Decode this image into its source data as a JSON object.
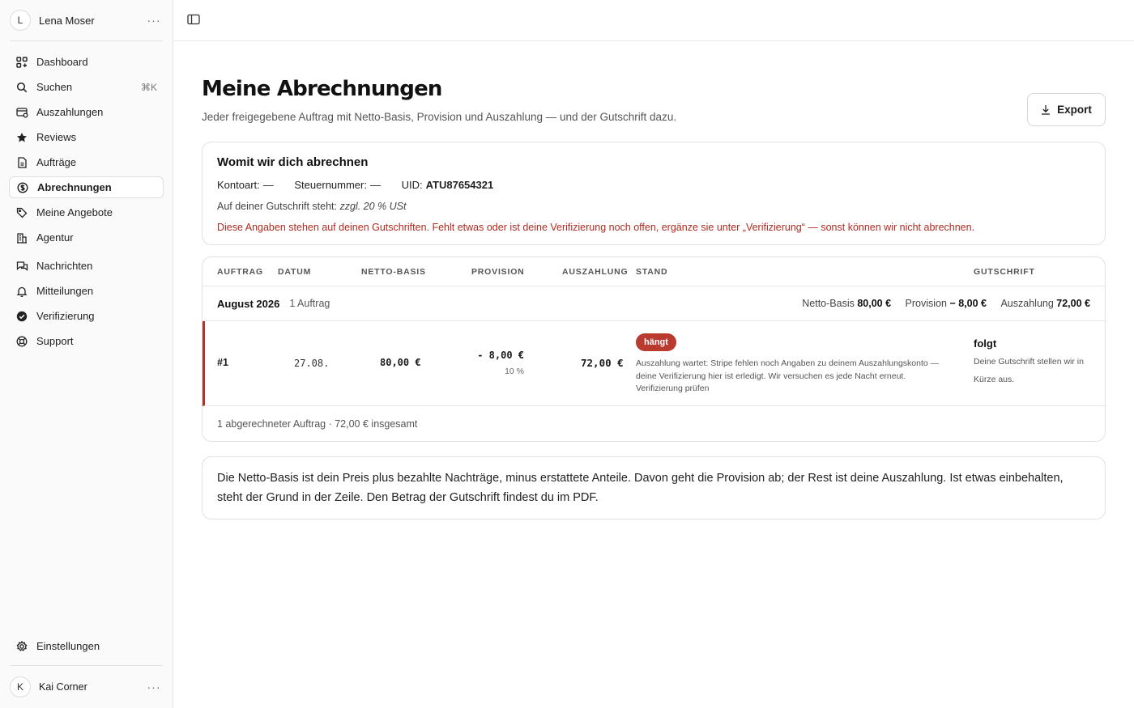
{
  "sidebar": {
    "account": {
      "initial": "L",
      "name": "Lena Moser",
      "menu": "···"
    },
    "items": [
      {
        "label": "Dashboard",
        "icon": "dashboard-icon"
      },
      {
        "label": "Suchen",
        "icon": "search-icon",
        "shortcut": "⌘K"
      },
      {
        "label": "Auszahlungen",
        "icon": "payout-icon"
      },
      {
        "label": "Reviews",
        "icon": "star-icon"
      },
      {
        "label": "Aufträge",
        "icon": "document-icon"
      },
      {
        "label": "Abrechnungen",
        "icon": "dollar-circle-icon",
        "active": true
      },
      {
        "label": "Meine Angebote",
        "icon": "tag-icon"
      },
      {
        "label": "Agentur",
        "icon": "building-icon"
      },
      {
        "label": "Nachrichten",
        "icon": "chat-icon"
      },
      {
        "label": "Mitteilungen",
        "icon": "bell-icon"
      },
      {
        "label": "Verifizierung",
        "icon": "check-circle-icon"
      },
      {
        "label": "Support",
        "icon": "lifebuoy-icon"
      }
    ],
    "settings": {
      "label": "Einstellungen",
      "icon": "gear-icon"
    },
    "user": {
      "initial": "K",
      "name": "Kai Corner",
      "menu": "···"
    }
  },
  "page": {
    "title": "Meine Abrechnungen",
    "subtitle": "Jeder freigegebene Auftrag mit Netto-Basis, Provision und Auszahlung — und der Gutschrift dazu.",
    "export_label": "Export"
  },
  "billing": {
    "title": "Womit wir dich abrechnen",
    "kontoart_label": "Kontoart:",
    "kontoart_value": "—",
    "steuer_label": "Steuernummer:",
    "steuer_value": "—",
    "uid_label": "UID:",
    "uid_value": "ATU87654321",
    "gutschrift_prefix": "Auf deiner Gutschrift steht:",
    "gutschrift_value": "zzgl. 20 % USt",
    "warning": "Diese Angaben stehen auf deinen Gutschriften. Fehlt etwas oder ist deine Verifizierung noch offen, ergänze sie unter „Verifizierung“ — sonst können wir nicht abrechnen."
  },
  "table": {
    "headers": {
      "auftrag": "AUFTRAG",
      "datum": "DATUM",
      "netto": "NETTO-BASIS",
      "provision": "PROVISION",
      "auszahlung": "AUSZAHLUNG",
      "stand": "STAND",
      "gutschrift": "GUTSCHRIFT"
    },
    "group": {
      "title": "August 2026",
      "count": "1 Auftrag",
      "netto_label": "Netto-Basis",
      "netto_value": "80,00 €",
      "provision_label": "Provision",
      "provision_value": "− 8,00 €",
      "auszahlung_label": "Auszahlung",
      "auszahlung_value": "72,00 €"
    },
    "row": {
      "id": "#1",
      "datum": "27.08.",
      "netto": "80,00 €",
      "provision": "- 8,00 €",
      "provision_rate": "10 %",
      "auszahlung": "72,00 €",
      "status_badge": "hängt",
      "status_text": "Auszahlung wartet: Stripe fehlen noch Angaben zu deinem Auszahlungskonto — deine Verifizierung hier ist erledigt. Wir versuchen es jede Nacht erneut.",
      "status_link": "Verifizierung prüfen",
      "gutschrift_title": "folgt",
      "gutschrift_text": "Deine Gutschrift stellen wir in Kürze aus."
    },
    "footer": "1 abgerechneter Auftrag · 72,00 € insgesamt"
  },
  "note": "Die Netto-Basis ist dein Preis plus bezahlte Nachträge, minus erstattete Anteile. Davon geht die Provision ab; der Rest ist deine Auszahlung. Ist etwas einbehalten, steht der Grund in der Zeile. Den Betrag der Gutschrift findest du im PDF.",
  "colors": {
    "accent_red": "#b93a2e",
    "warning_text": "#b02a20",
    "row_marker": "#b3302a"
  }
}
